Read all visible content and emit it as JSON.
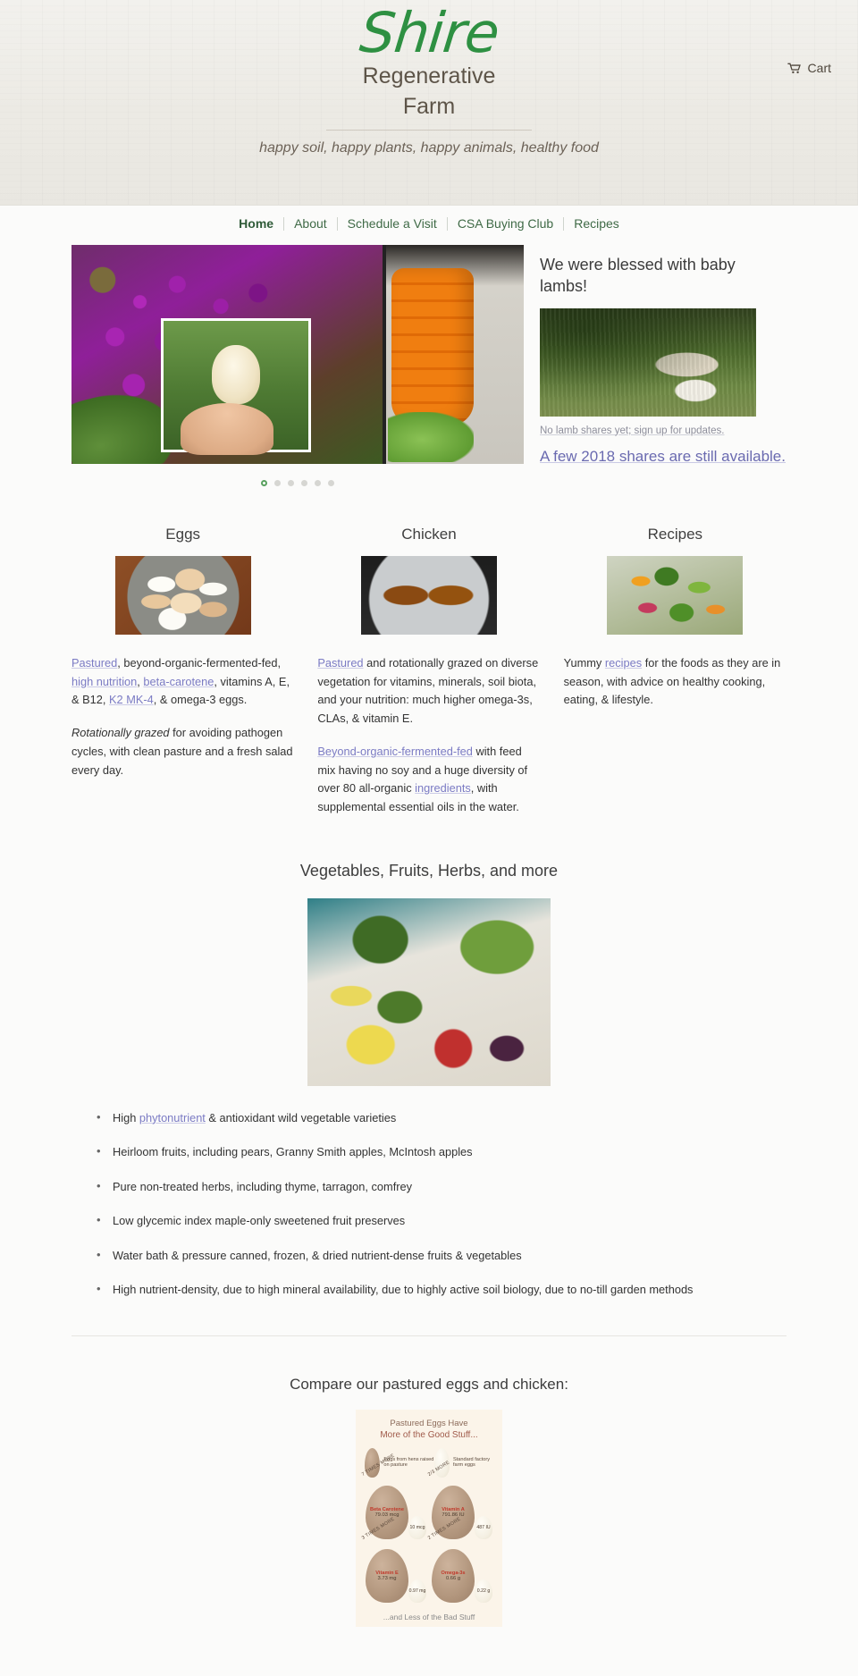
{
  "header": {
    "brand_name": "Shire",
    "brand_line2": "Regenerative",
    "brand_line3": "Farm",
    "tagline": "happy soil, happy plants, happy animals, healthy food",
    "cart_label": "Cart",
    "cart_icon": "shopping-cart-icon"
  },
  "nav": {
    "items": [
      {
        "label": "Home",
        "active": true
      },
      {
        "label": "About",
        "active": false
      },
      {
        "label": "Schedule a Visit",
        "active": false
      },
      {
        "label": "CSA Buying Club",
        "active": false
      },
      {
        "label": "Recipes",
        "active": false
      }
    ]
  },
  "hero": {
    "slider": {
      "slide_count": 6,
      "active_index": 0,
      "slide_alt_left": "purple-cauliflower-and-apple-core-collage",
      "slide_alt_right": "sliced-orange-carrots-on-cutting-board"
    },
    "aside": {
      "title": "We were blessed with baby lambs!",
      "photo_alt": "ewe-nursing-lamb-in-pasture",
      "note": "No lamb shares yet; sign up for updates.",
      "link": "A few 2018 shares are still available."
    }
  },
  "columns": [
    {
      "title": "Eggs",
      "image_alt": "bowl-of-brown-and-white-eggs",
      "p1_parts": [
        {
          "t": "Pastured",
          "k": "link"
        },
        {
          "t": ", beyond-organic-fermented-fed, ",
          "k": "text"
        },
        {
          "t": "high nutrition",
          "k": "link"
        },
        {
          "t": ", ",
          "k": "text"
        },
        {
          "t": "beta-carotene",
          "k": "link"
        },
        {
          "t": ", vitamins A, E, & B12, ",
          "k": "text"
        },
        {
          "t": "K2 MK-4",
          "k": "link"
        },
        {
          "t": ", & omega-3 eggs.",
          "k": "text"
        }
      ],
      "p2_parts": [
        {
          "t": "Rotationally grazed",
          "k": "italic"
        },
        {
          "t": " for avoiding pathogen cycles, with clean pasture and a fresh salad every day.",
          "k": "text"
        }
      ]
    },
    {
      "title": "Chicken",
      "image_alt": "two-roasted-chickens-on-platter",
      "p1_parts": [
        {
          "t": "Pastured",
          "k": "link"
        },
        {
          "t": " and rotationally grazed on diverse vegetation for vitamins, minerals, soil biota, and your nutrition: much higher omega-3s, CLAs, & vitamin E.",
          "k": "text"
        }
      ],
      "p2_parts": [
        {
          "t": "Beyond-organic-fermented-fed",
          "k": "link"
        },
        {
          "t": " with feed mix having no soy and a huge diversity of over 80 all-organic ",
          "k": "text"
        },
        {
          "t": "ingredients",
          "k": "link"
        },
        {
          "t": ", with supplemental essential oils in the water.",
          "k": "text"
        }
      ]
    },
    {
      "title": "Recipes",
      "image_alt": "stir-fried-mixed-vegetables",
      "p1_parts": [
        {
          "t": "Yummy ",
          "k": "text"
        },
        {
          "t": "recipes",
          "k": "link"
        },
        {
          "t": " for the foods as they are in season, with advice on healthy cooking, eating, & lifestyle.",
          "k": "text"
        }
      ],
      "p2_parts": []
    }
  ],
  "veg_section": {
    "title": "Vegetables, Fruits, Herbs, and more",
    "image_alt": "broccoli-green-beans-squash-peppers-on-counter",
    "bullets": [
      [
        {
          "t": "High ",
          "k": "text"
        },
        {
          "t": "phytonutrient",
          "k": "link"
        },
        {
          "t": " & antioxidant wild vegetable varieties",
          "k": "text"
        }
      ],
      [
        {
          "t": "Heirloom fruits, including pears, Granny Smith apples, McIntosh apples",
          "k": "text"
        }
      ],
      [
        {
          "t": "Pure non-treated herbs, including thyme, tarragon, comfrey",
          "k": "text"
        }
      ],
      [
        {
          "t": "Low glycemic index maple-only sweetened fruit preserves",
          "k": "text"
        }
      ],
      [
        {
          "t": "Water bath & pressure canned, frozen, & dried nutrient-dense fruits & vegetables",
          "k": "text"
        }
      ],
      [
        {
          "t": "High nutrient-density, due to high mineral availability, due to highly active soil biology, due to no-till garden methods",
          "k": "text"
        }
      ]
    ]
  },
  "compare": {
    "title": "Compare our pastured eggs and chicken:",
    "infographic": {
      "title_line1": "Pastured Eggs Have",
      "title_line2": "More of the Good Stuff...",
      "legend_pasture": "Eggs from hens raised on pasture",
      "legend_factory": "Standard factory farm eggs",
      "footer": "...and Less of the Bad Stuff",
      "rows": [
        {
          "left": {
            "times": "7 TIMES MORE",
            "nutrient": "Beta Carotene",
            "value": "79.03 mcg",
            "small_value": "10 mcg"
          },
          "right": {
            "times": "2/3 MORE",
            "nutrient": "Vitamin A",
            "value": "791.86 IU",
            "small_value": "487 IU"
          }
        },
        {
          "left": {
            "times": "3 TIMES MORE",
            "nutrient": "Vitamin E",
            "value": "3.73 mg",
            "small_value": "0.97 mg"
          },
          "right": {
            "times": "2 TIMES MORE",
            "nutrient": "Omega-3s",
            "value": "0.66 g",
            "small_value": "0.22 g"
          }
        }
      ]
    }
  },
  "colors": {
    "brand_green": "#2e9042",
    "nav_green": "#3f6a46",
    "link_purple": "#7b7bc4",
    "aside_link": "#6a6ab0",
    "text": "#333333"
  }
}
